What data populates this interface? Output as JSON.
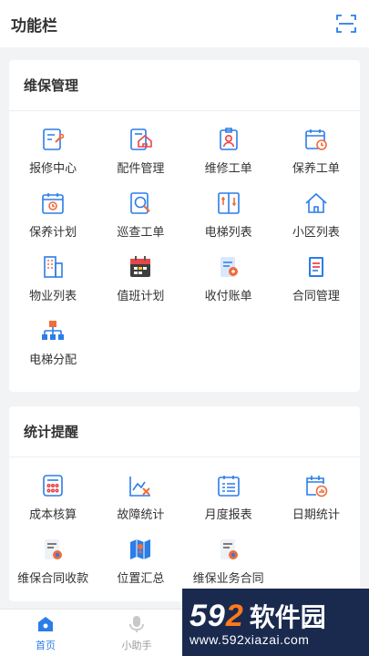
{
  "header": {
    "title": "功能栏",
    "scan_icon": "scan-icon"
  },
  "maintenance": {
    "title": "维保管理",
    "items": [
      {
        "label": "报修中心",
        "icon": "wrench-doc-icon"
      },
      {
        "label": "配件管理",
        "icon": "parts-house-icon"
      },
      {
        "label": "维修工单",
        "icon": "repair-worker-icon"
      },
      {
        "label": "保养工单",
        "icon": "calendar-clock-icon"
      },
      {
        "label": "保养计划",
        "icon": "calendar-plan-icon"
      },
      {
        "label": "巡查工单",
        "icon": "magnify-doc-icon"
      },
      {
        "label": "电梯列表",
        "icon": "elevator-icon"
      },
      {
        "label": "小区列表",
        "icon": "house-icon"
      },
      {
        "label": "物业列表",
        "icon": "building-icon"
      },
      {
        "label": "值班计划",
        "icon": "duty-calendar-icon"
      },
      {
        "label": "收付账单",
        "icon": "bill-icon"
      },
      {
        "label": "合同管理",
        "icon": "contract-icon"
      },
      {
        "label": "电梯分配",
        "icon": "org-chart-icon"
      }
    ]
  },
  "statistics": {
    "title": "统计提醒",
    "items": [
      {
        "label": "成本核算",
        "icon": "calculator-icon"
      },
      {
        "label": "故障统计",
        "icon": "fault-chart-icon"
      },
      {
        "label": "月度报表",
        "icon": "monthly-report-icon"
      },
      {
        "label": "日期统计",
        "icon": "date-stat-icon"
      },
      {
        "label": "维保合同收款",
        "icon": "contract-payment-icon"
      },
      {
        "label": "位置汇总",
        "icon": "map-icon"
      },
      {
        "label": "维保业务合同",
        "icon": "business-contract-icon"
      }
    ]
  },
  "tabbar": {
    "items": [
      {
        "label": "首页",
        "active": true,
        "icon": "home-icon"
      },
      {
        "label": "小助手",
        "active": false,
        "icon": "mic-icon"
      }
    ]
  },
  "watermark": {
    "num_a": "59",
    "num_b": "2",
    "cn": "软件园",
    "url": "www.592xiazai.com"
  },
  "colors": {
    "accent": "#2b7de9",
    "orange": "#f26b3a",
    "red": "#e8464b",
    "grey": "#999999"
  }
}
